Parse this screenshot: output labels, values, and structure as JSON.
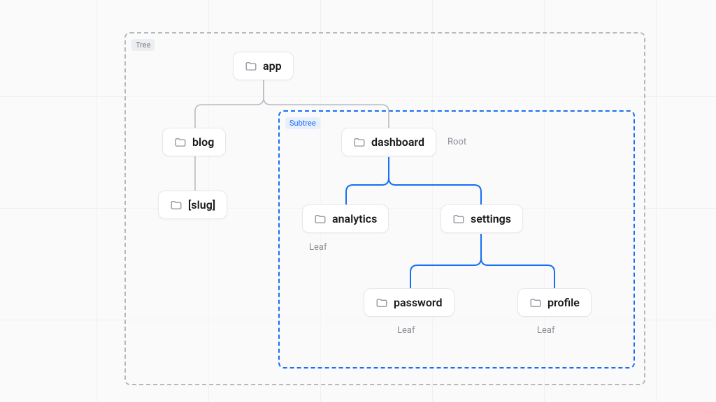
{
  "panel": {
    "tree_label": "Tree",
    "subtree_label": "Subtree"
  },
  "annotations": {
    "root": "Root",
    "leaf": "Leaf"
  },
  "nodes": {
    "app": {
      "label": "app"
    },
    "blog": {
      "label": "blog"
    },
    "slug": {
      "label": "[slug]"
    },
    "dashboard": {
      "label": "dashboard"
    },
    "analytics": {
      "label": "analytics"
    },
    "settings": {
      "label": "settings"
    },
    "password": {
      "label": "password"
    },
    "profile": {
      "label": "profile"
    }
  },
  "colors": {
    "accent": "#176ff4",
    "edge_gray": "#b8bdc4",
    "edge_blue": "#176ff4"
  }
}
